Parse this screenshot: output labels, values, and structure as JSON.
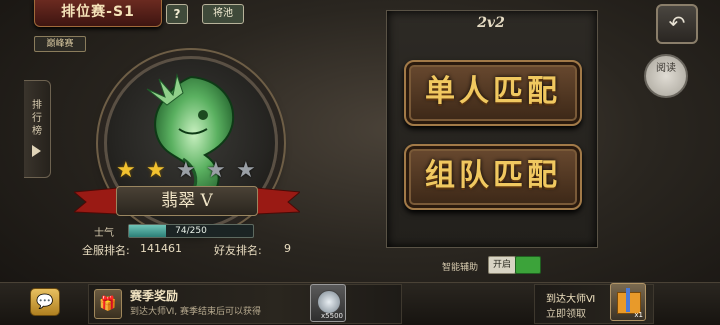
{
  "header": {
    "title": "排位赛-S1",
    "help_label": "?",
    "pool_label": "将池",
    "peak_tag": "巅峰赛"
  },
  "sidebar": {
    "ranking_label": "排行榜"
  },
  "rank": {
    "name": "翡翠 V",
    "stars_filled": 2,
    "stars_total": 5,
    "morale_label": "士气",
    "morale_value": "74/250",
    "morale_fraction": 0.296,
    "server_rank_label": "全服排名:",
    "server_rank_value": "141461",
    "friend_rank_label": "好友排名:",
    "friend_rank_value": "9"
  },
  "mode_panel": {
    "title": "2v2",
    "solo_match_label": "单人匹配",
    "team_match_label": "组队匹配",
    "assist_label": "智能辅助",
    "assist_button": "开启"
  },
  "top_right": {
    "read_label": "阅读"
  },
  "bottom": {
    "season_reward_title": "赛季奖励",
    "season_reward_desc": "到达大师Ⅵ, 赛季结束后可以获得",
    "coin_qty": "x5500",
    "master_line1": "到达大师Ⅵ",
    "master_line2": "立即领取",
    "gift_qty": "x1"
  },
  "icons": {
    "back": "back-arrow-icon",
    "chat": "chat-bubble-icon",
    "gift": "gift-icon",
    "coin": "silver-coin-icon",
    "emblem": "jade-dragon-emblem"
  },
  "colors": {
    "star_on": "#f2c230",
    "star_off": "#9aa0a6",
    "match_text": "#f0c860",
    "assist_on": "#3ca33a"
  }
}
